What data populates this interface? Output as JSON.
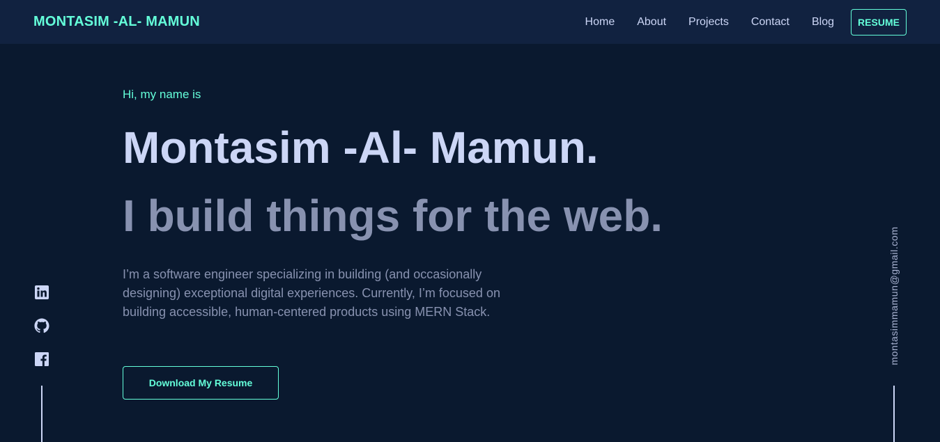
{
  "header": {
    "brand": "MONTASIM -AL- MAMUN",
    "nav": [
      "Home",
      "About",
      "Projects",
      "Contact",
      "Blog"
    ],
    "resume_label": "RESUME"
  },
  "hero": {
    "greeting": "Hi, my name is",
    "name": "Montasim -Al- Mamun.",
    "tagline": "I build things for the web.",
    "bio": "I’m a software engineer specializing in building (and occasionally designing) exceptional digital experiences. Currently, I’m focused on building accessible, human-centered products using MERN Stack.",
    "cta_label": "Download My Resume"
  },
  "social": {
    "icons": [
      "linkedin-icon",
      "github-icon",
      "facebook-icon"
    ]
  },
  "email": "montasimmamun@gmail.com",
  "colors": {
    "background": "#0a192f",
    "navbar": "#112240",
    "accent": "#64ffda",
    "heading": "#ccd6f6",
    "muted": "#8892b0"
  }
}
